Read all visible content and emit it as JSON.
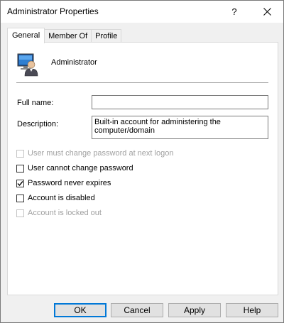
{
  "window": {
    "title": "Administrator Properties",
    "help_glyph": "?",
    "close_glyph": "✕"
  },
  "tabs": [
    {
      "label": "General",
      "active": true
    },
    {
      "label": "Member Of",
      "active": false
    },
    {
      "label": "Profile",
      "active": false
    }
  ],
  "general": {
    "user_icon": "user-computer-icon",
    "username": "Administrator",
    "full_name_label": "Full name:",
    "full_name_value": "",
    "description_label": "Description:",
    "description_value": "Built-in account for administering the computer/domain",
    "options": [
      {
        "label": "User must change password at next logon",
        "checked": false,
        "enabled": false
      },
      {
        "label": "User cannot change password",
        "checked": false,
        "enabled": true
      },
      {
        "label": "Password never expires",
        "checked": true,
        "enabled": true
      },
      {
        "label": "Account is disabled",
        "checked": false,
        "enabled": true
      },
      {
        "label": "Account is locked out",
        "checked": false,
        "enabled": false
      }
    ]
  },
  "buttons": {
    "ok": "OK",
    "cancel": "Cancel",
    "apply": "Apply",
    "help": "Help"
  },
  "colors": {
    "window_bg": "#f0f0f0",
    "panel_bg": "#ffffff",
    "default_button_border": "#0078d7",
    "disabled_text": "#a0a0a0"
  }
}
